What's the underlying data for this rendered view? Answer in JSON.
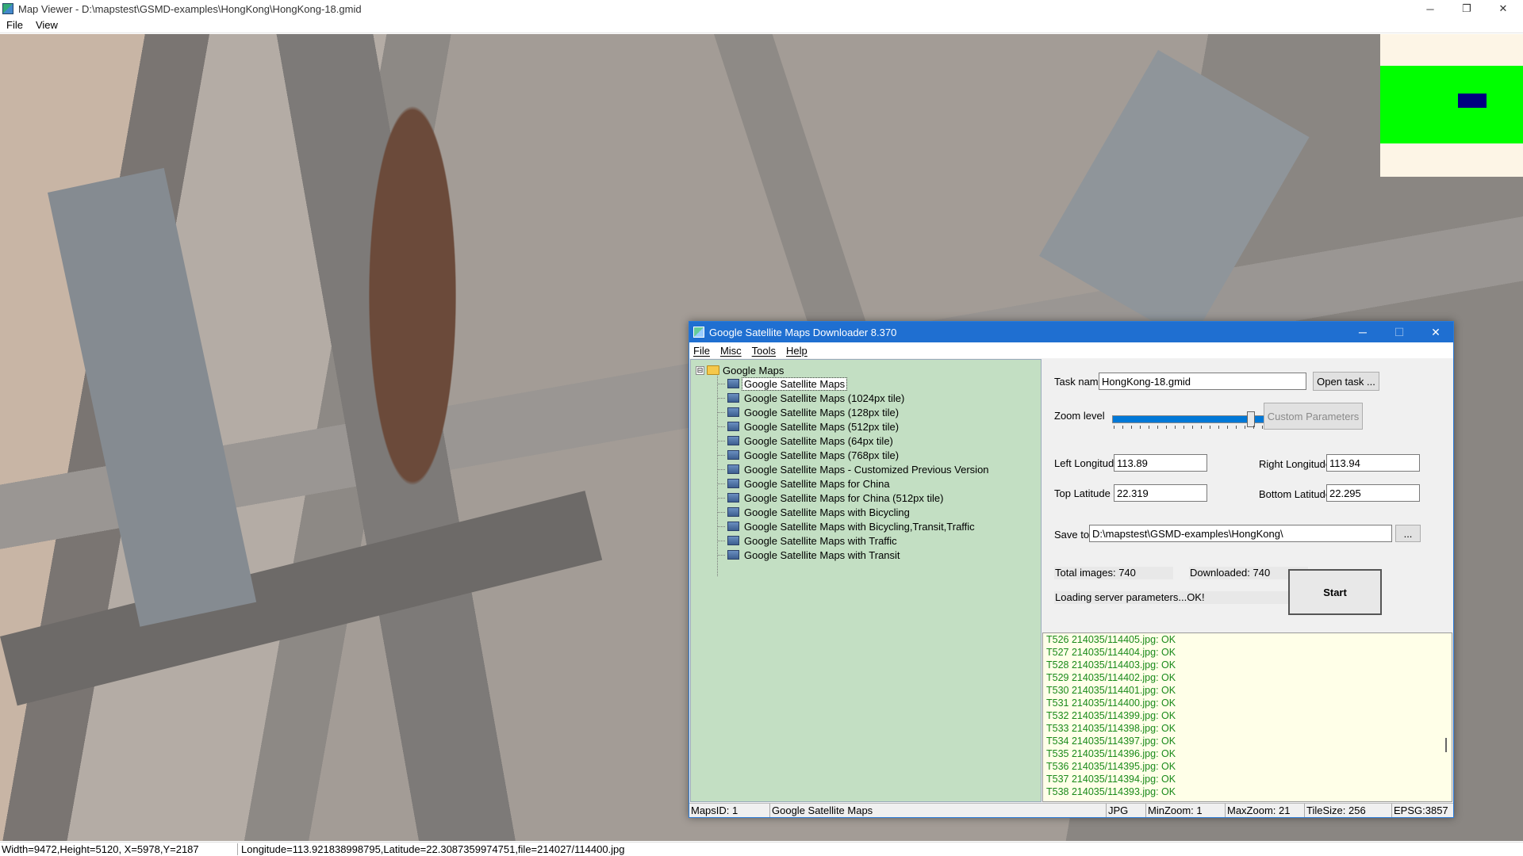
{
  "window": {
    "title": "Map Viewer - D:\\mapstest\\GSMD-examples\\HongKong\\HongKong-18.gmid",
    "minimize_glyph": "─",
    "maximize_glyph": "❐",
    "close_glyph": "✕"
  },
  "menubar": {
    "items": [
      "File",
      "View"
    ]
  },
  "overview": {
    "background": "#fdf5e6",
    "area_color": "#00ff00",
    "viewport_color": "#000080"
  },
  "statusbar": {
    "size_info": "Width=9472,Height=5120, X=5978,Y=2187",
    "coord_info": "Longitude=113.921838998795,Latitude=22.3087359974751,file=214027/114400.jpg"
  },
  "dialog": {
    "title": "Google Satellite Maps Downloader 8.370",
    "menu": [
      "File",
      "Misc",
      "Tools",
      "Help"
    ],
    "tree": {
      "root": "Google Maps",
      "expander": "⊟",
      "items": [
        "Google Satellite Maps",
        "Google Satellite Maps (1024px tile)",
        "Google Satellite Maps (128px tile)",
        "Google Satellite Maps (512px tile)",
        "Google Satellite Maps (64px tile)",
        "Google Satellite Maps (768px tile)",
        "Google Satellite Maps - Customized Previous Version",
        "Google Satellite Maps for China",
        "Google Satellite Maps for China (512px tile)",
        "Google Satellite Maps with Bicycling",
        "Google Satellite Maps with Bicycling,Transit,Traffic",
        "Google Satellite Maps with Traffic",
        "Google Satellite Maps with Transit"
      ],
      "selected_index": 0
    },
    "form": {
      "task_name_label": "Task name",
      "task_name_value": "HongKong-18.gmid",
      "open_task_label": "Open task ...",
      "zoom_label": "Zoom level",
      "zoom_value": "18",
      "custom_params_label": "Custom Parameters",
      "left_lon_label": "Left Longitude",
      "left_lon_value": "113.89",
      "right_lon_label": "Right Longitude",
      "right_lon_value": "113.94",
      "top_lat_label": "Top Latitude",
      "top_lat_value": "22.319",
      "bottom_lat_label": "Bottom Latitude",
      "bottom_lat_value": "22.295",
      "save_to_label": "Save to",
      "save_to_value": "D:\\mapstest\\GSMD-examples\\HongKong\\",
      "browse_label": "...",
      "total_images": "Total images: 740",
      "downloaded": "Downloaded: 740",
      "status_msg": "Loading server parameters...OK!",
      "start_label": "Start"
    },
    "log": [
      "T526 214035/114405.jpg: OK",
      "T527 214035/114404.jpg: OK",
      "T528 214035/114403.jpg: OK",
      "T529 214035/114402.jpg: OK",
      "T530 214035/114401.jpg: OK",
      "T531 214035/114400.jpg: OK",
      "T532 214035/114399.jpg: OK",
      "T533 214035/114398.jpg: OK",
      "T534 214035/114397.jpg: OK",
      "T535 214035/114396.jpg: OK",
      "T536 214035/114395.jpg: OK",
      "T537 214035/114394.jpg: OK",
      "T538 214035/114393.jpg: OK"
    ],
    "status": {
      "maps_id": "MapsID: 1",
      "map_name": "Google Satellite Maps",
      "format": "JPG",
      "min_zoom": "MinZoom: 1",
      "max_zoom": "MaxZoom: 21",
      "tile_size": "TileSize: 256",
      "epsg": "EPSG:3857"
    }
  }
}
